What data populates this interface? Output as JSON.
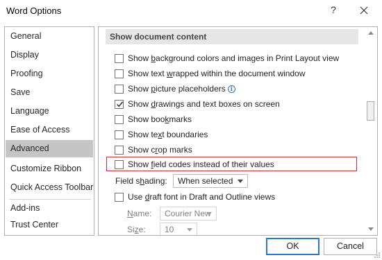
{
  "window": {
    "title": "Word Options",
    "help_glyph": "?",
    "close_glyph": "close"
  },
  "sidebar": {
    "items": [
      {
        "label": "General"
      },
      {
        "label": "Display"
      },
      {
        "label": "Proofing"
      },
      {
        "label": "Save"
      },
      {
        "label": "Language"
      },
      {
        "label": "Ease of Access"
      },
      {
        "label": "Advanced",
        "selected": true
      },
      {
        "label": "Customize Ribbon"
      },
      {
        "label": "Quick Access Toolbar"
      },
      {
        "label": "Add-ins"
      },
      {
        "label": "Trust Center"
      }
    ]
  },
  "section": {
    "header": "Show document content",
    "options": [
      {
        "pre": "Show ",
        "accel": "b",
        "post": "ackground colors and images in Print Layout view",
        "checked": false
      },
      {
        "pre": "Show text ",
        "accel": "w",
        "post": "rapped within the document window",
        "checked": false
      },
      {
        "pre": "Show ",
        "accel": "p",
        "post": "icture placeholders",
        "checked": false,
        "info_icon": "info-icon"
      },
      {
        "pre": "Show ",
        "accel": "d",
        "post": "rawings and text boxes on screen",
        "checked": true
      },
      {
        "pre": "Show boo",
        "accel": "k",
        "post": "marks",
        "checked": false
      },
      {
        "pre": "Show te",
        "accel": "x",
        "post": "t boundaries",
        "checked": false
      },
      {
        "pre": "Show c",
        "accel": "r",
        "post": "op marks",
        "checked": false
      },
      {
        "pre": "Show ",
        "accel": "f",
        "post": "ield codes instead of their values",
        "checked": false,
        "highlighted": true
      }
    ],
    "field_shading": {
      "label_pre": "Field s",
      "label_accel": "h",
      "label_post": "ading:",
      "value": "When selected"
    },
    "draft_font": {
      "pre": "Use ",
      "accel": "d",
      "post": "raft font in Draft and Outline views",
      "checked": false
    },
    "name": {
      "label_pre": "",
      "label_accel": "N",
      "label_post": "ame:",
      "value": "Courier New"
    },
    "size": {
      "label_pre": "Si",
      "label_accel": "z",
      "label_post": "e:",
      "value": "10"
    }
  },
  "buttons": {
    "ok": "OK",
    "cancel": "Cancel"
  },
  "colors": {
    "highlight_border": "#d9272e",
    "selected_nav": "#c5c5c5",
    "default_button_border": "#2b78c9"
  }
}
